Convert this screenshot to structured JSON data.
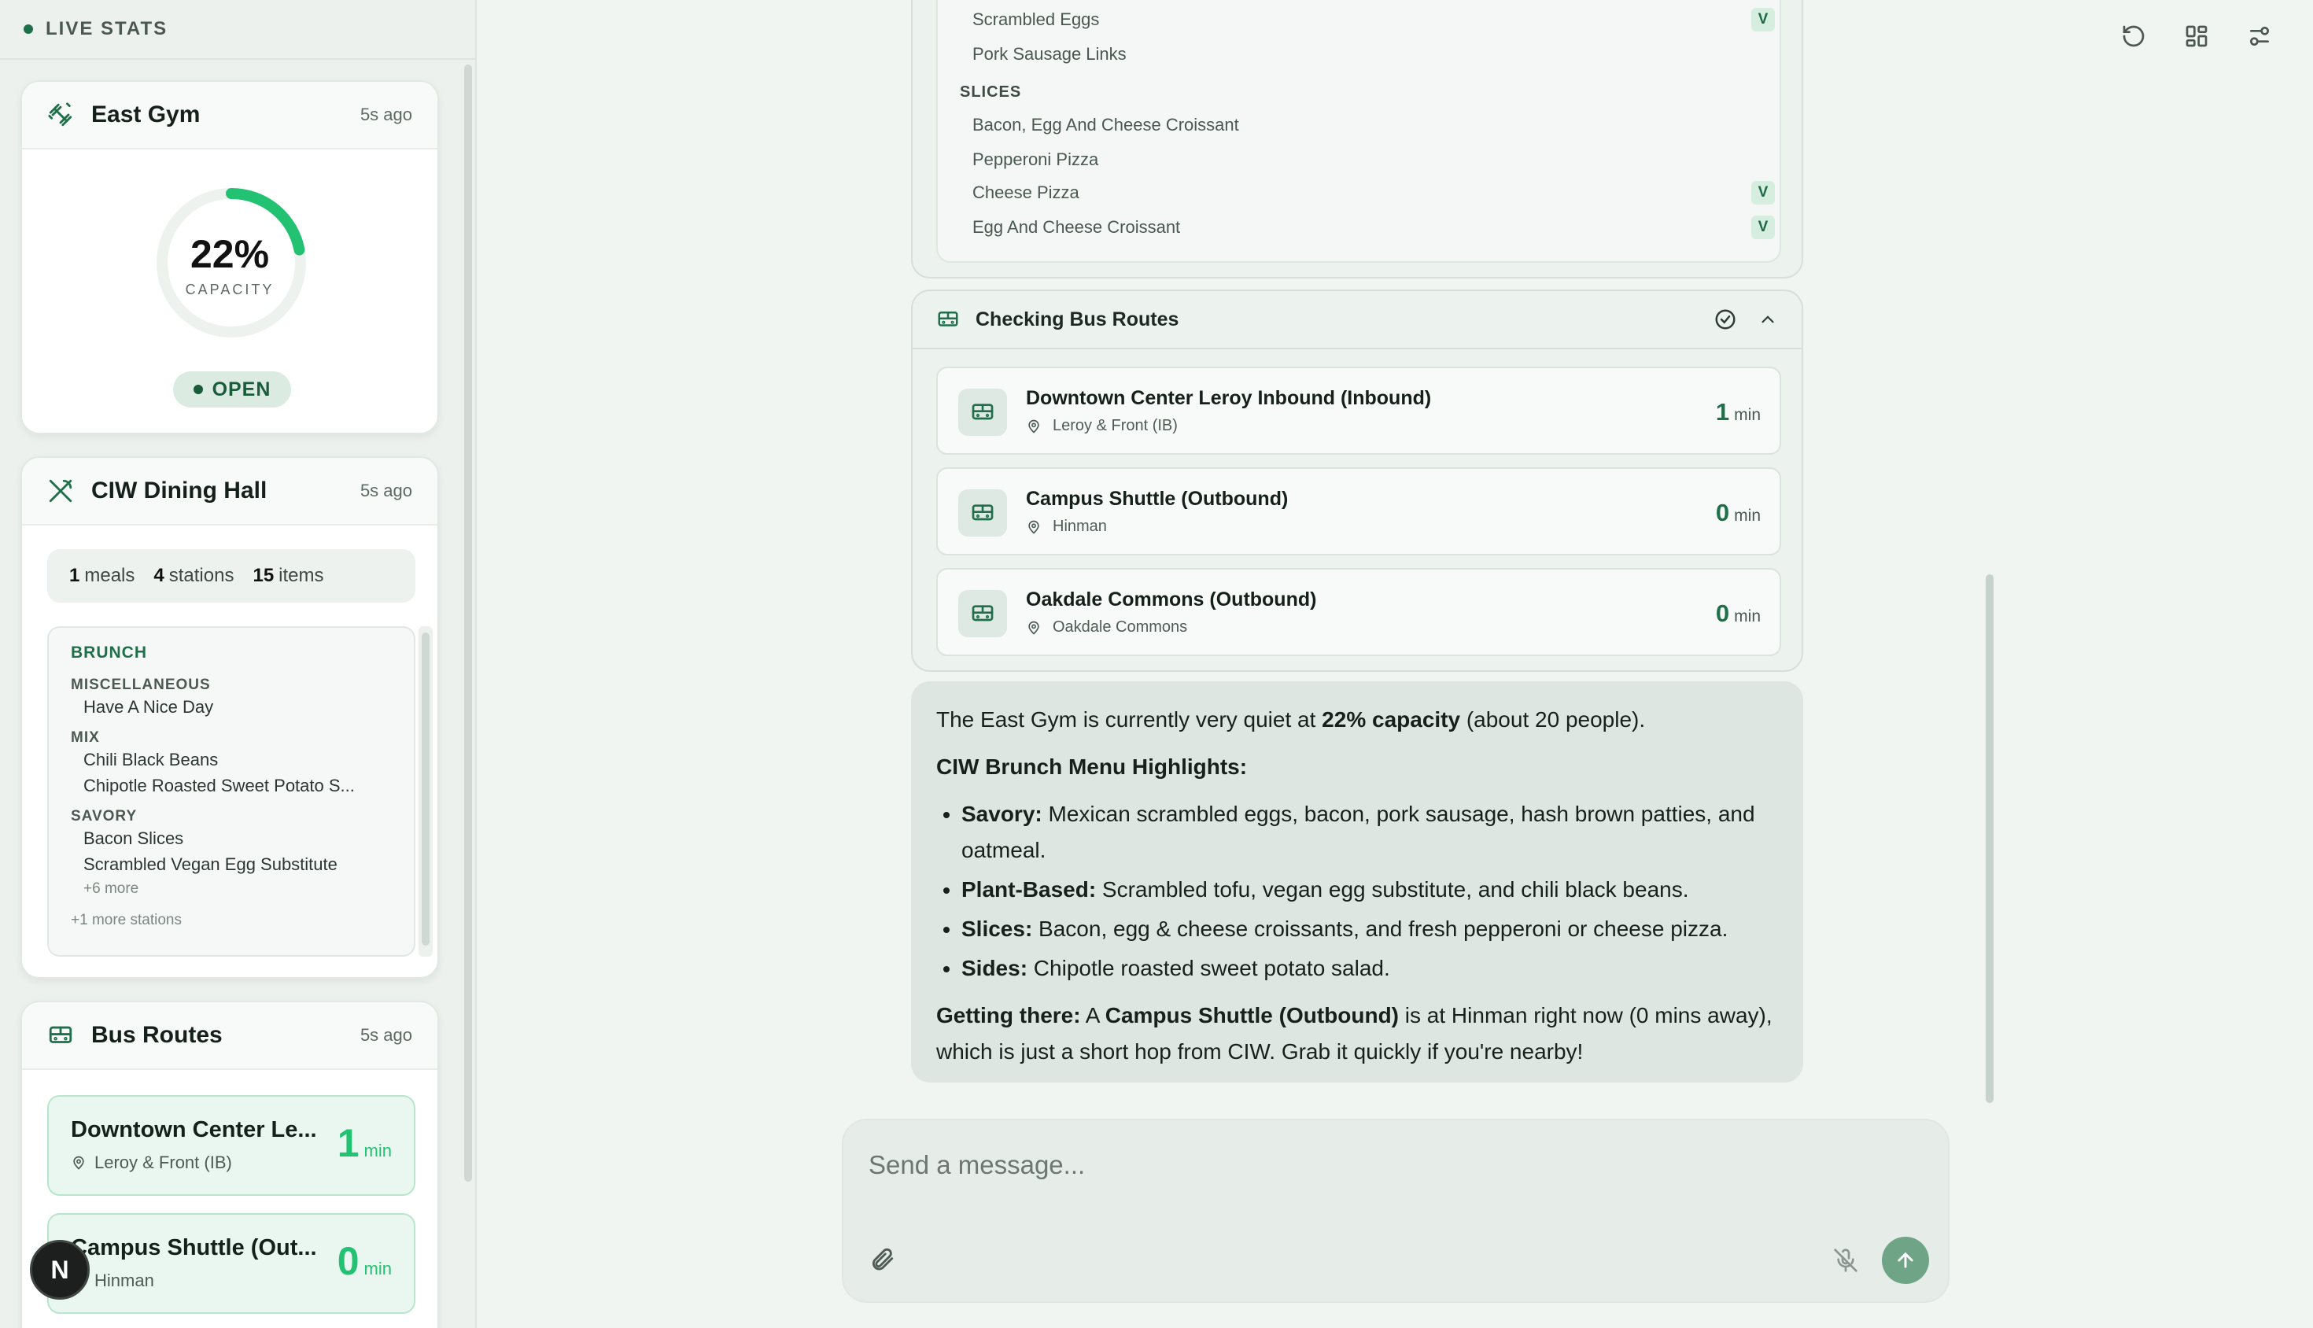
{
  "sidebar": {
    "header": "LIVE STATS",
    "gym": {
      "title": "East Gym",
      "ago": "5s ago",
      "capacity_value": "22%",
      "capacity_fraction": 0.22,
      "capacity_label": "CAPACITY",
      "status": "OPEN"
    },
    "dining": {
      "title": "CIW Dining Hall",
      "ago": "5s ago",
      "meals_n": "1",
      "meals_l": "meals",
      "stations_n": "4",
      "stations_l": "stations",
      "items_n": "15",
      "items_l": "items",
      "meal": "BRUNCH",
      "stations": [
        {
          "name": "MISCELLANEOUS",
          "items": [
            "Have A Nice Day"
          ]
        },
        {
          "name": "MIX",
          "items": [
            "Chili Black Beans",
            "Chipotle Roasted Sweet Potato S..."
          ]
        },
        {
          "name": "SAVORY",
          "items": [
            "Bacon Slices",
            "Scrambled Vegan Egg Substitute"
          ]
        }
      ],
      "more_items": "+6 more",
      "more_stations": "+1 more stations"
    },
    "bus": {
      "title": "Bus Routes",
      "ago": "5s ago",
      "routes": [
        {
          "name": "Downtown Center Le...",
          "stop": "Leroy & Front (IB)",
          "min": "1",
          "unit": "min"
        },
        {
          "name": "Campus Shuttle (Out...",
          "stop": "Hinman",
          "min": "0",
          "unit": "min"
        }
      ]
    },
    "avatar": "N"
  },
  "menu_panel": {
    "items_top": [
      {
        "name": "Scrambled Eggs",
        "veg": "V"
      },
      {
        "name": "Pork Sausage Links",
        "veg": ""
      }
    ],
    "slices_label": "SLICES",
    "slices": [
      {
        "name": "Bacon, Egg And Cheese Croissant",
        "veg": ""
      },
      {
        "name": "Pepperoni Pizza",
        "veg": ""
      },
      {
        "name": "Cheese Pizza",
        "veg": "V"
      },
      {
        "name": "Egg And Cheese Croissant",
        "veg": "V"
      }
    ]
  },
  "bus_panel": {
    "title": "Checking Bus Routes",
    "routes": [
      {
        "name": "Downtown Center Leroy Inbound (Inbound)",
        "stop": "Leroy & Front (IB)",
        "min": "1",
        "unit": "min"
      },
      {
        "name": "Campus Shuttle (Outbound)",
        "stop": "Hinman",
        "min": "0",
        "unit": "min"
      },
      {
        "name": "Oakdale Commons (Outbound)",
        "stop": "Oakdale Commons",
        "min": "0",
        "unit": "min"
      }
    ]
  },
  "answer": {
    "p1_a": "The East Gym is currently very quiet at ",
    "p1_b": "22% capacity",
    "p1_c": " (about 20 people).",
    "heading": "CIW Brunch Menu Highlights:",
    "bullets": [
      {
        "label": "Savory:",
        "text": " Mexican scrambled eggs, bacon, pork sausage, hash brown patties, and oatmeal."
      },
      {
        "label": "Plant-Based:",
        "text": " Scrambled tofu, vegan egg substitute, and chili black beans."
      },
      {
        "label": "Slices:",
        "text": " Bacon, egg & cheese croissants, and fresh pepperoni or cheese pizza."
      },
      {
        "label": "Sides:",
        "text": " Chipotle roasted sweet potato salad."
      }
    ],
    "p3_label": "Getting there:",
    "p3_a": " A ",
    "p3_b": "Campus Shuttle (Outbound)",
    "p3_c": " is at Hinman right now (0 mins away), which is just a short hop from CIW. Grab it quickly if you're nearby!"
  },
  "composer": {
    "placeholder": "Send a message..."
  },
  "colors": {
    "accent": "#22c272",
    "brand_dark": "#1f6f4a"
  },
  "icons": [
    "dumbbell-icon",
    "utensils-icon",
    "bus-icon",
    "map-pin-icon",
    "check-circle-icon",
    "chevron-up-icon",
    "refresh-icon",
    "layout-grid-icon",
    "sliders-icon",
    "paperclip-icon",
    "mic-off-icon",
    "arrow-up-icon"
  ]
}
